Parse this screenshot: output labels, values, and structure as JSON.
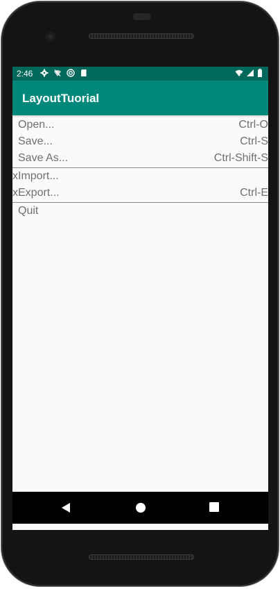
{
  "status_bar": {
    "time": "2:46",
    "left_icons": [
      "gear-icon",
      "wifi-off-icon",
      "sync-icon",
      "sd-card-icon"
    ],
    "right_icons": [
      "wifi-icon",
      "signal-icon",
      "battery-icon"
    ],
    "color": "#00695c"
  },
  "app_bar": {
    "title": "LayoutTuorial",
    "color": "#00897b"
  },
  "menu": {
    "items": [
      {
        "label": "Open...",
        "shortcut": "Ctrl-O"
      },
      {
        "label": "Save...",
        "shortcut": "Ctrl-S"
      },
      {
        "label": "Save As...",
        "shortcut": "Ctrl-Shift-S"
      },
      {
        "label": "xImport...",
        "shortcut": ""
      },
      {
        "label": "xExport...",
        "shortcut": "Ctrl-E"
      },
      {
        "label": "Quit",
        "shortcut": ""
      }
    ]
  },
  "nav_bar": {
    "buttons": [
      "back-icon",
      "home-icon",
      "recents-icon"
    ]
  }
}
